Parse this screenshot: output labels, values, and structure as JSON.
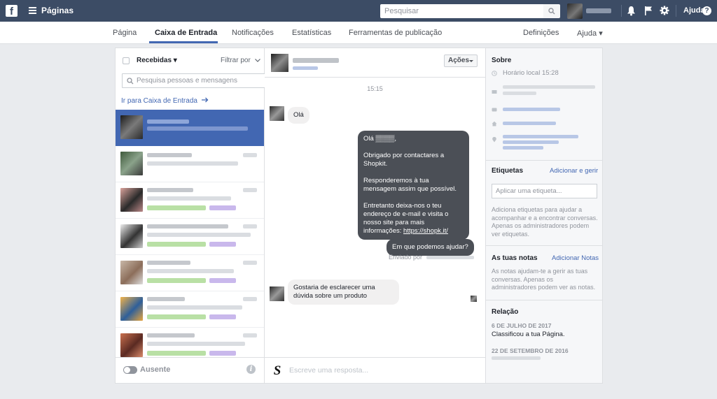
{
  "topbar": {
    "logo": "f",
    "title": "Páginas",
    "search_placeholder": "Pesquisar",
    "help": "Ajuda",
    "help_icon": "?"
  },
  "nav": {
    "items": [
      "Página",
      "Caixa de Entrada",
      "Notificações",
      "Estatísticas",
      "Ferramentas de publicação"
    ],
    "settings": "Definições",
    "help": "Ajuda ▾",
    "active": "Caixa de Entrada"
  },
  "inbox": {
    "filter_label": "Recebidas ▾",
    "filter_by": "Filtrar por",
    "search_placeholder": "Pesquisa pessoas e mensagens",
    "goto_inbox": "Ir para Caixa de Entrada",
    "status_label": "Ausente",
    "info_icon": "i"
  },
  "chat": {
    "actions_label": "Ações",
    "time": "15:15",
    "messages": [
      {
        "from": "user",
        "text": "Olá"
      },
      {
        "from": "page",
        "p1": "Olá ▒▒▒▒,",
        "p2": "Obrigado por contactares a Shopkit.",
        "p3": "Responderemos à tua mensagem assim que possível.",
        "p4": "Entretanto deixa-nos o teu endereço de e-mail e visita o nosso site para mais informações:",
        "link": "https://shopk.it/"
      },
      {
        "from": "page",
        "text": "Em que podemos ajudar?"
      },
      {
        "from": "user",
        "text": "Gostaria de esclarecer uma dúvida sobre um produto"
      }
    ],
    "sent_by": "Enviado por",
    "compose_placeholder": "Escreve uma resposta...",
    "logo": "S"
  },
  "about": {
    "title": "Sobre",
    "local_time": "Horário local 15:28",
    "labels_title": "Etiquetas",
    "labels_link": "Adicionar e gerir",
    "labels_placeholder": "Aplicar uma etiqueta...",
    "labels_help": "Adiciona etiquetas para ajudar a acompanhar e a encontrar conversas. Apenas os administradores podem ver etiquetas.",
    "notes_title": "As tuas notas",
    "notes_link": "Adicionar Notas",
    "notes_help": "As notas ajudam-te a gerir as tuas conversas. Apenas os administradores podem ver as notas.",
    "relation_title": "Relação",
    "relation_date1": "6 DE JULHO DE 2017",
    "relation_text1": "Classificou a tua Página.",
    "relation_date2": "22 DE SETEMBRO DE 2016"
  },
  "colors": {
    "topbar": "#3c4c65",
    "accent": "#4267b2",
    "bubble_out": "#4b4f56"
  }
}
